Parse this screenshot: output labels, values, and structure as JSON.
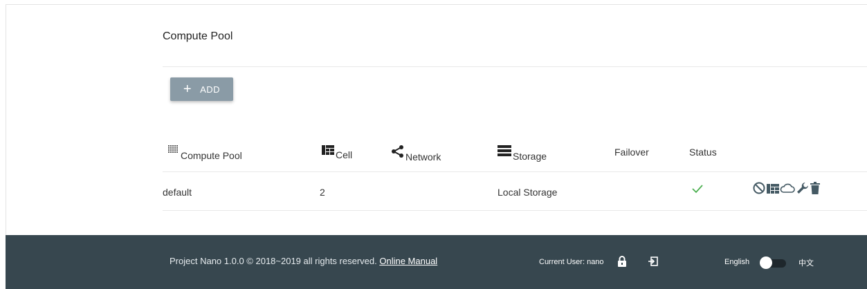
{
  "card": {
    "title": "Compute Pool",
    "add_label": "ADD",
    "add_icon": "plus-icon"
  },
  "table": {
    "headers": {
      "compute_pool": "Compute Pool",
      "cell": "Cell",
      "network": "Network",
      "storage": "Storage",
      "failover": "Failover",
      "status": "Status"
    },
    "header_icons": {
      "compute_pool": "grid-dots-icon",
      "cell": "cells-icon",
      "network": "share-icon",
      "storage": "storage-icon"
    },
    "rows": [
      {
        "name": "default",
        "cell": "2",
        "network": "",
        "storage": "Local Storage",
        "failover": "",
        "status": "check-icon",
        "operations": [
          "disable-icon",
          "cells-icon",
          "cloud-icon",
          "wrench-icon",
          "trash-icon"
        ]
      }
    ]
  },
  "footer": {
    "copyright": "Project Nano 1.0.0 © 2018~2019 all rights reserved.",
    "manual_link": "Online Manual",
    "current_user": "Current User: nano",
    "lang_en": "English",
    "lang_zh": "中文"
  },
  "colors": {
    "accent_button": "#8a9ba6",
    "footer_bg": "#37474f",
    "status_ok": "#4caf50",
    "icon": "#455a64"
  }
}
